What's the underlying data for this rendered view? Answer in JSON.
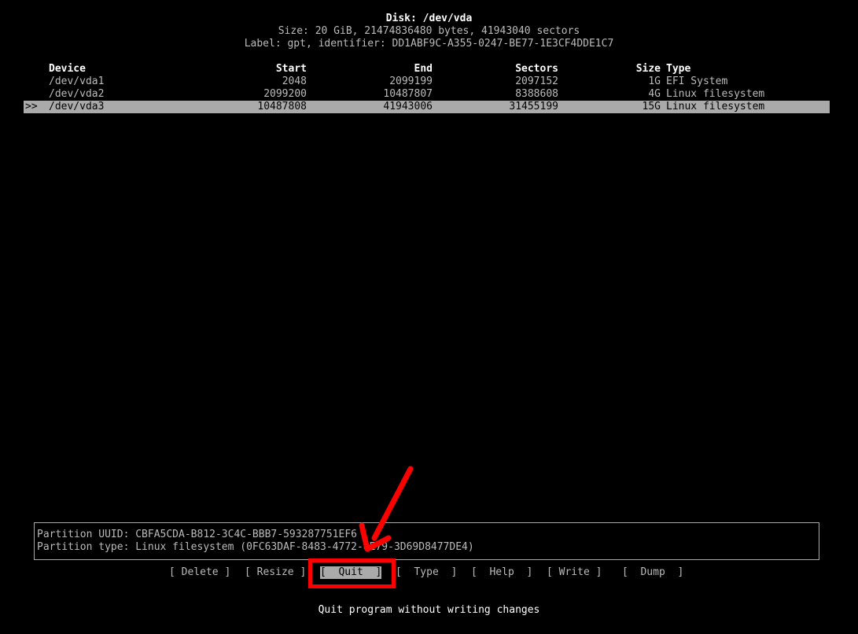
{
  "disk": {
    "title": "Disk: /dev/vda",
    "size_line": "Size: 20 GiB, 21474836480 bytes, 41943040 sectors",
    "label_line": "Label: gpt, identifier: DD1ABF9C-A355-0247-BE77-1E3CF4DDE1C7"
  },
  "table": {
    "headers": {
      "device": "Device",
      "start": "Start",
      "end": "End",
      "sectors": "Sectors",
      "size": "Size",
      "type": "Type"
    },
    "rows": [
      {
        "marker": "",
        "device": "/dev/vda1",
        "start": "2048",
        "end": "2099199",
        "sectors": "2097152",
        "size": "1G",
        "type": "EFI System"
      },
      {
        "marker": "",
        "device": "/dev/vda2",
        "start": "2099200",
        "end": "10487807",
        "sectors": "8388608",
        "size": "4G",
        "type": "Linux filesystem"
      },
      {
        "marker": ">>",
        "device": "/dev/vda3",
        "start": "10487808",
        "end": "41943006",
        "sectors": "31455199",
        "size": "15G",
        "type": "Linux filesystem"
      }
    ]
  },
  "info": {
    "uuid_line": "Partition UUID: CBFA5CDA-B812-3C4C-BBB7-593287751EF6",
    "type_line": "Partition type: Linux filesystem (0FC63DAF-8483-4772-8E79-3D69D8477DE4)"
  },
  "menu": {
    "delete": "[ Delete ]",
    "resize": "[ Resize ]",
    "quit": "[  Quit  ]",
    "type": "[  Type  ]",
    "help": "[  Help  ]",
    "write": "[ Write ]",
    "dump": "[  Dump  ]"
  },
  "status": {
    "hint": "Quit program without writing changes"
  },
  "colors": {
    "background": "#000000",
    "text": "#bbbbbb",
    "selection": "#aaaaaa",
    "annotation": "#ff0000"
  }
}
